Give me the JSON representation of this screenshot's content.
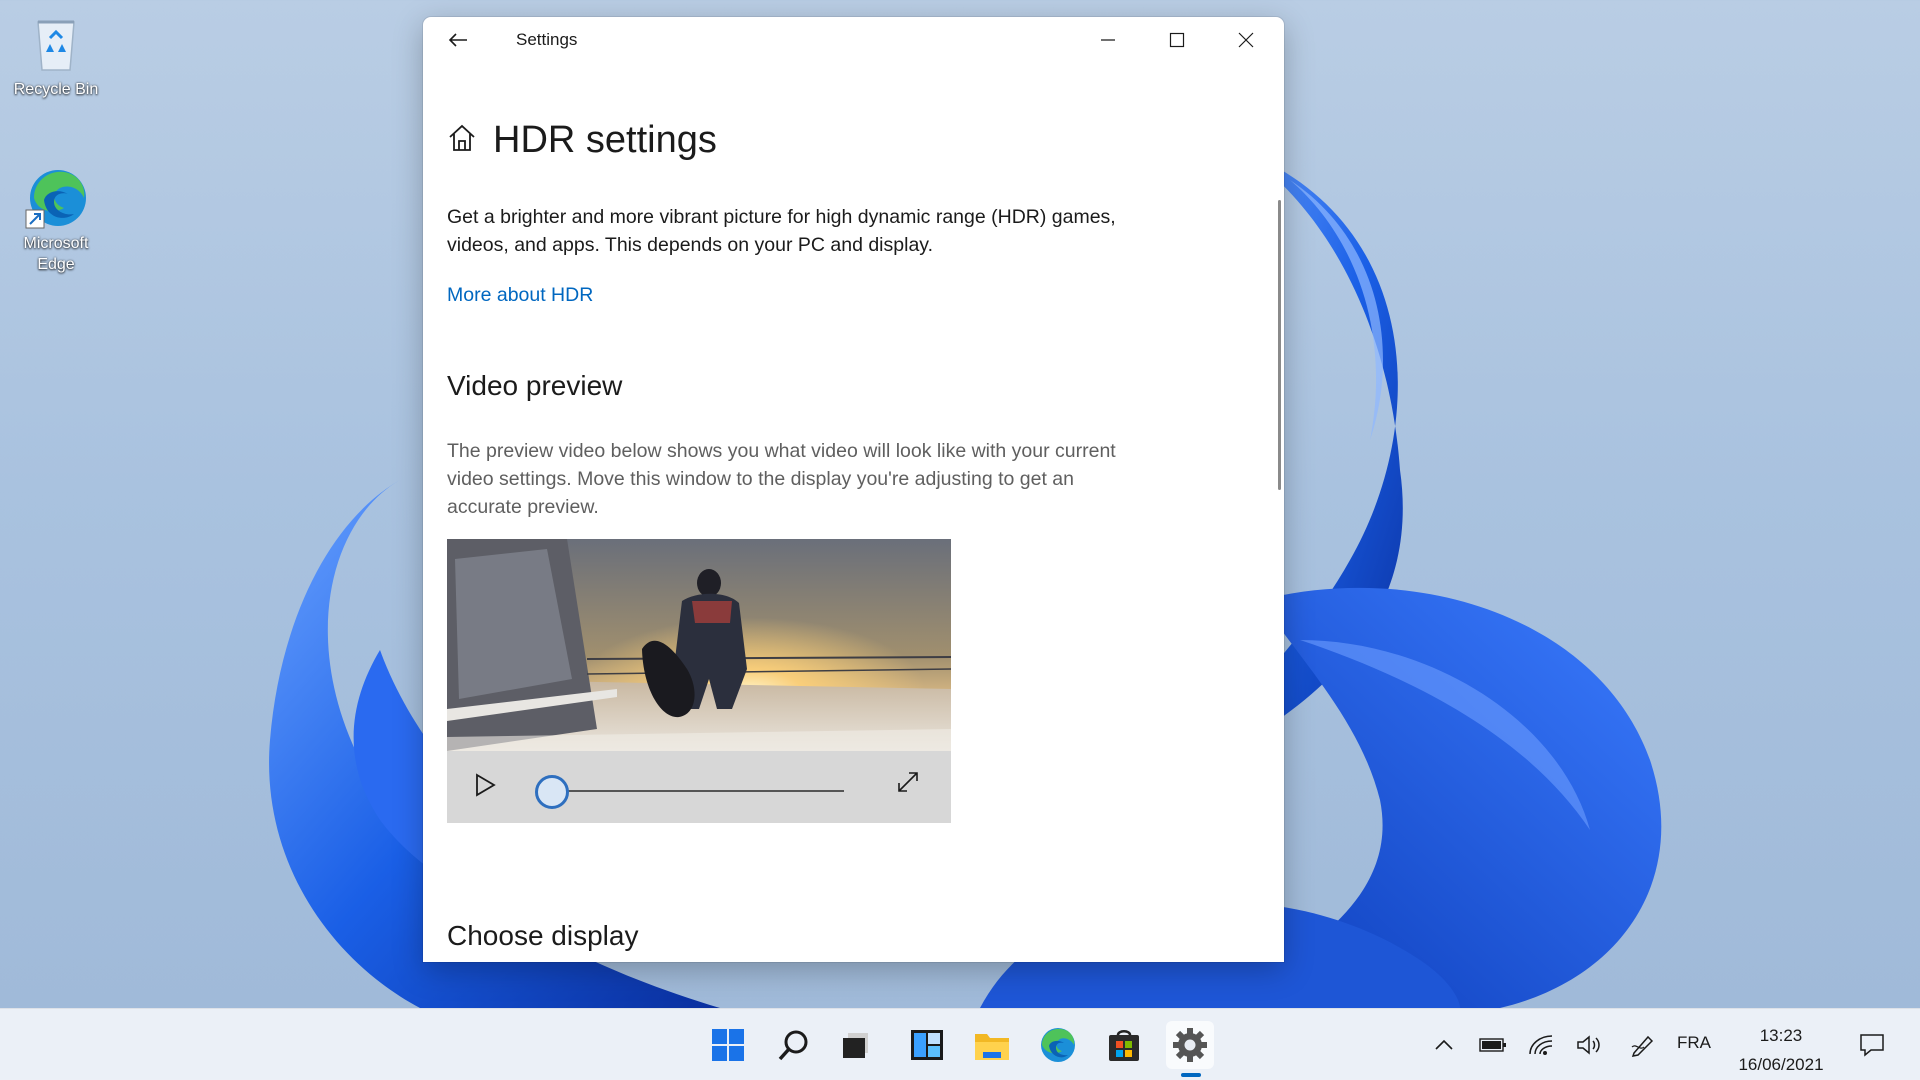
{
  "desktop": {
    "icons": [
      {
        "label": "Recycle Bin",
        "icon": "recycle-bin-icon"
      },
      {
        "label": "Microsoft Edge",
        "icon": "edge-icon"
      }
    ]
  },
  "window": {
    "title": "Settings",
    "page_title": "HDR settings",
    "description": "Get a brighter and more vibrant picture for high dynamic range (HDR) games, videos, and apps. This depends on your PC and display.",
    "link": "More about HDR",
    "video_preview_heading": "Video preview",
    "video_preview_description": "The preview video below shows you what video will look like with your current video settings. Move this window to the display you're adjusting to get an accurate preview.",
    "video_progress": 0,
    "choose_display_heading": "Choose display"
  },
  "taskbar": {
    "apps": [
      "start-icon",
      "search-icon",
      "task-view-icon",
      "widgets-icon",
      "file-explorer-icon",
      "edge-icon",
      "store-icon",
      "settings-icon"
    ],
    "active_app": "settings-icon",
    "tray": {
      "language": "FRA",
      "time": "13:23",
      "date": "16/06/2021"
    }
  },
  "colors": {
    "accent": "#0067c0",
    "wallpaper_blue": "#1f5fe0"
  }
}
